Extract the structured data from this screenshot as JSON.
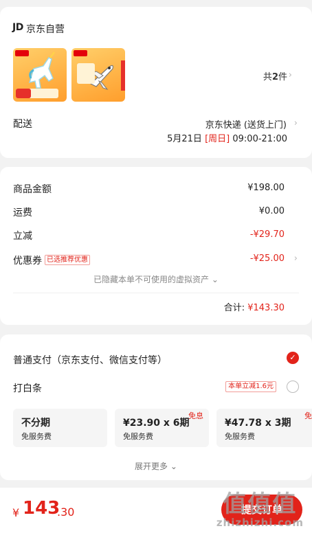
{
  "shop": {
    "logo": "JD",
    "name": "京东自营",
    "item_count_prefix": "共",
    "item_count": "2",
    "item_count_suffix": "件",
    "products": [
      {
        "icon": "unicorn-toy-product-image"
      },
      {
        "icon": "space-shuttle-toy-product-image"
      }
    ]
  },
  "shipping": {
    "label": "配送",
    "method": "京东快递 (送货上门)",
    "date": "5月21日",
    "weekday": "[周日]",
    "time": "09:00-21:00"
  },
  "price": {
    "goods_label": "商品金额",
    "goods_value": "¥198.00",
    "freight_label": "运费",
    "freight_value": "¥0.00",
    "discount_label": "立减",
    "discount_value": "-¥29.70",
    "coupon_label": "优惠券",
    "coupon_tag": "已选推荐优惠",
    "coupon_value": "-¥25.00",
    "hidden_note": "已隐藏本单不可使用的虚拟资产",
    "total_label": "合计:",
    "total_value": "¥143.30"
  },
  "payment": {
    "normal_label": "普通支付（京东支付、微信支付等）",
    "baitiao_label": "打白条",
    "promo_tag": "本单立减1.6元",
    "plans": [
      {
        "title": "不分期",
        "sub": "免服务费",
        "badge": ""
      },
      {
        "title": "¥23.90 x 6期",
        "sub": "免服务费",
        "badge": "免息"
      },
      {
        "title": "¥47.78 x 3期",
        "sub": "免服务费",
        "badge": "免"
      }
    ],
    "expand_label": "展开更多"
  },
  "bottom": {
    "currency": "¥",
    "amount_int": "143",
    "amount_dec": ".30",
    "submit_label": "提交订单"
  },
  "watermark": {
    "big": "值值值",
    "small": "zhizhizhi.com"
  },
  "colors": {
    "accent": "#e2231a",
    "background": "#f2f2f2"
  }
}
